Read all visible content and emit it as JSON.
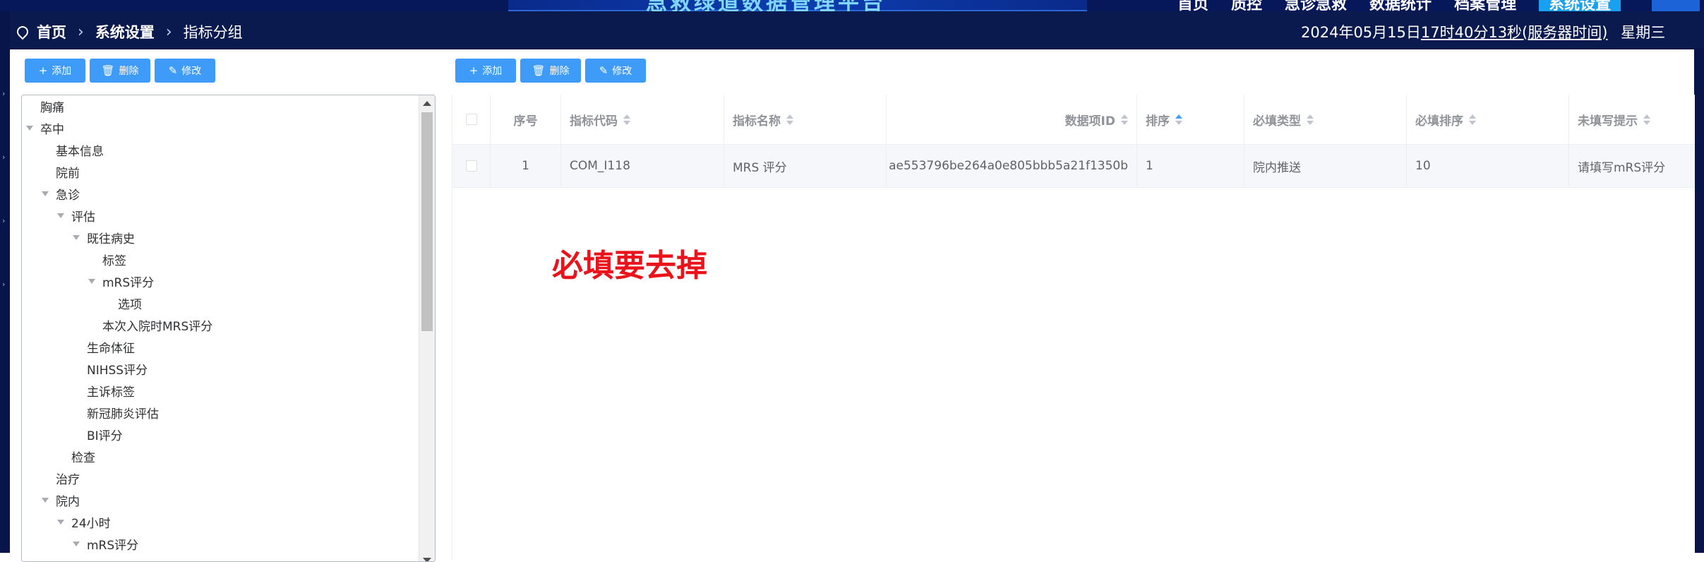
{
  "header": {
    "app_title": "急救绿道数据管理平台",
    "nav": [
      "首页",
      "质控",
      "急诊急救",
      "数据统计",
      "档案管理",
      "系统设置"
    ],
    "active_nav": "系统设置"
  },
  "breadcrumb": {
    "home": "首页",
    "section": "系统设置",
    "current": "指标分组"
  },
  "clock": {
    "date": "2024年05月15日",
    "time": "17时40分13秒(服务器时间)",
    "weekday": "星期三"
  },
  "left_toolbar": {
    "add": "添加",
    "delete": "删除",
    "edit": "修改"
  },
  "right_toolbar": {
    "add": "添加",
    "delete": "删除",
    "edit": "修改"
  },
  "tree": [
    {
      "label": "胸痛",
      "level": 0,
      "expanded": null
    },
    {
      "label": "卒中",
      "level": 0,
      "expanded": true
    },
    {
      "label": "基本信息",
      "level": 1,
      "expanded": null
    },
    {
      "label": "院前",
      "level": 1,
      "expanded": null
    },
    {
      "label": "急诊",
      "level": 1,
      "expanded": true
    },
    {
      "label": "评估",
      "level": 2,
      "expanded": true
    },
    {
      "label": "既往病史",
      "level": 3,
      "expanded": true
    },
    {
      "label": "标签",
      "level": 4,
      "expanded": null
    },
    {
      "label": "mRS评分",
      "level": 4,
      "expanded": true
    },
    {
      "label": "选项",
      "level": 5,
      "expanded": null
    },
    {
      "label": "本次入院时MRS评分",
      "level": 4,
      "expanded": null
    },
    {
      "label": "生命体征",
      "level": 3,
      "expanded": null
    },
    {
      "label": "NIHSS评分",
      "level": 3,
      "expanded": null
    },
    {
      "label": "主诉标签",
      "level": 3,
      "expanded": null
    },
    {
      "label": "新冠肺炎评估",
      "level": 3,
      "expanded": null
    },
    {
      "label": "BI评分",
      "level": 3,
      "expanded": null
    },
    {
      "label": "检查",
      "level": 2,
      "expanded": null
    },
    {
      "label": "治疗",
      "level": 1,
      "expanded": null
    },
    {
      "label": "院内",
      "level": 1,
      "expanded": true
    },
    {
      "label": "24小时",
      "level": 2,
      "expanded": true
    },
    {
      "label": "mRS评分",
      "level": 3,
      "expanded": true
    }
  ],
  "table": {
    "columns": [
      "序号",
      "指标代码",
      "指标名称",
      "数据项ID",
      "排序",
      "必填类型",
      "必填排序",
      "未填写提示"
    ],
    "rows": [
      [
        "1",
        "COM_I118",
        "MRS 评分",
        "ae553796be264a0e805bbb5a21f1350b",
        "1",
        "院内推送",
        "10",
        "请填写mRS评分"
      ]
    ],
    "sorted_column": "排序",
    "sort_direction": "ascending"
  },
  "annotation": "必填要去掉",
  "colors": {
    "header_bg": "#0a1a4e",
    "button_blue": "#3e9bf7",
    "annotation_red": "#e8131b",
    "sort_active": "#409eff"
  }
}
